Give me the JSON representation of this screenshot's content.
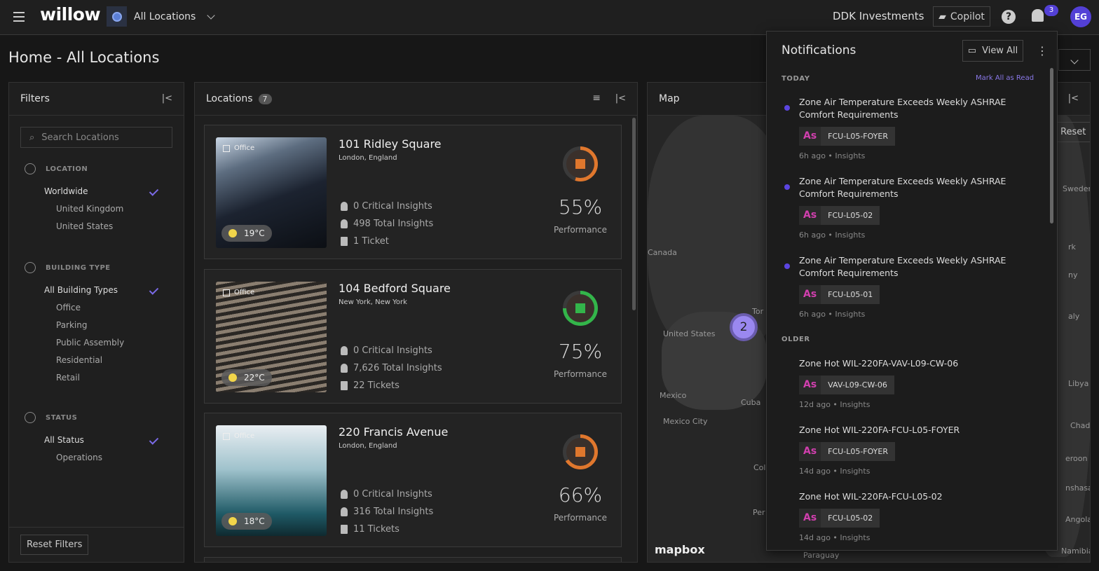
{
  "topbar": {
    "logo": "willow",
    "location": "All Locations",
    "org": "DDK Investments",
    "copilot": "Copilot",
    "help": "?",
    "notif_count": "3",
    "avatar": "EG"
  },
  "page_title": "Home - All Locations",
  "filters": {
    "title": "Filters",
    "search_placeholder": "Search Locations",
    "sections": [
      {
        "label": "LOCATION",
        "items": [
          "Worldwide",
          "United Kingdom",
          "United States"
        ]
      },
      {
        "label": "BUILDING TYPE",
        "items": [
          "All Building Types",
          "Office",
          "Parking",
          "Public Assembly",
          "Residential",
          "Retail"
        ]
      },
      {
        "label": "STATUS",
        "items": [
          "All Status",
          "Operations"
        ]
      }
    ],
    "reset": "Reset Filters"
  },
  "locations": {
    "title": "Locations",
    "count": "7",
    "cards": [
      {
        "type": "Office",
        "temp": "19°C",
        "name": "101 Ridley Square",
        "address": "London, England",
        "critical": "0 Critical Insights",
        "total": "498 Total Insights",
        "tickets": "1 Ticket",
        "performance": "55%",
        "perf_value": 55,
        "perf_label": "Performance",
        "color": "#e0772d"
      },
      {
        "type": "Office",
        "temp": "22°C",
        "name": "104 Bedford Square",
        "address": "New York, New York",
        "critical": "0 Critical Insights",
        "total": "7,626 Total Insights",
        "tickets": "22 Tickets",
        "performance": "75%",
        "perf_value": 75,
        "perf_label": "Performance",
        "color": "#33b54a"
      },
      {
        "type": "Office",
        "temp": "18°C",
        "name": "220 Francis Avenue",
        "address": "London, England",
        "critical": "0 Critical Insights",
        "total": "316 Total Insights",
        "tickets": "11 Tickets",
        "performance": "66%",
        "perf_value": 66,
        "perf_label": "Performance",
        "color": "#e0772d"
      }
    ]
  },
  "map": {
    "title": "Map",
    "reset": "Reset",
    "cluster": "2",
    "attribution": "mapbox",
    "labels": [
      "Canada",
      "United States",
      "Mexico",
      "Mexico City",
      "Cuba",
      "Tor",
      "Col",
      "Per",
      "Paraguay",
      "Sweden",
      "rk",
      "ny",
      "aly",
      "Libya",
      "Chad",
      "eroon",
      "nshasa",
      "Angola",
      "Namibia"
    ]
  },
  "notifications": {
    "title": "Notifications",
    "view_all": "View All",
    "today": "TODAY",
    "mark_all": "Mark All as Read",
    "older": "OLDER",
    "today_items": [
      {
        "title": "Zone Air Temperature Exceeds Weekly ASHRAE Comfort Requirements",
        "asset": "FCU-L05-FOYER",
        "time": "6h ago",
        "source": "Insights"
      },
      {
        "title": "Zone Air Temperature Exceeds Weekly ASHRAE Comfort Requirements",
        "asset": "FCU-L05-02",
        "time": "6h ago",
        "source": "Insights"
      },
      {
        "title": "Zone Air Temperature Exceeds Weekly ASHRAE Comfort Requirements",
        "asset": "FCU-L05-01",
        "time": "6h ago",
        "source": "Insights"
      }
    ],
    "older_items": [
      {
        "title": "Zone Hot WIL-220FA-VAV-L09-CW-06",
        "asset": "VAV-L09-CW-06",
        "time": "12d ago",
        "source": "Insights"
      },
      {
        "title": "Zone Hot WIL-220FA-FCU-L05-FOYER",
        "asset": "FCU-L05-FOYER",
        "time": "14d ago",
        "source": "Insights"
      },
      {
        "title": "Zone Hot WIL-220FA-FCU-L05-02",
        "asset": "FCU-L05-02",
        "time": "14d ago",
        "source": "Insights"
      }
    ],
    "asset_badge": "As"
  }
}
